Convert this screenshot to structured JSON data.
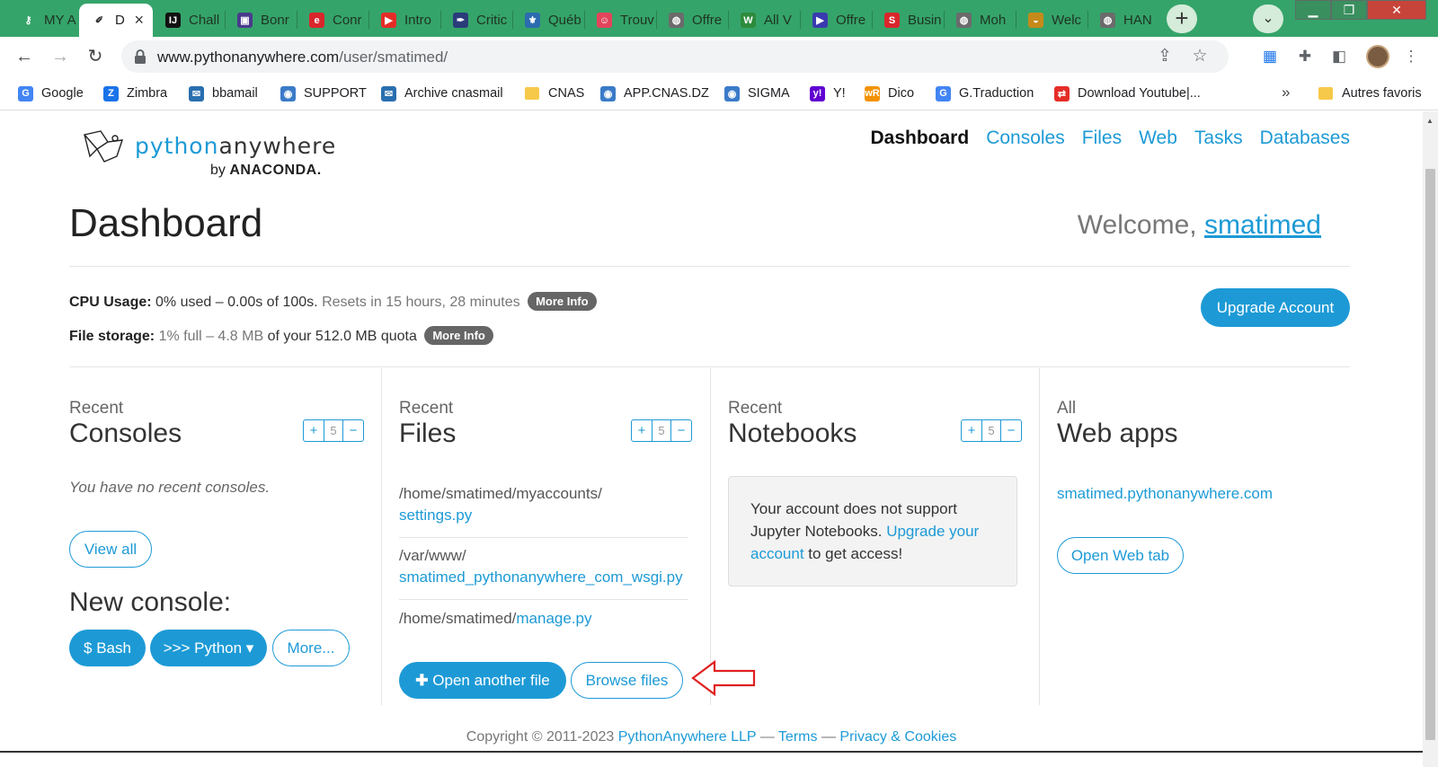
{
  "browser": {
    "tabs": [
      {
        "label": "MY A",
        "icon": "key-icon",
        "color": "#35a46a",
        "glyph": "⚷"
      },
      {
        "label": "D",
        "icon": "pythonanywhere-icon",
        "color": "#ffffff",
        "glyph": "✐",
        "active": true
      },
      {
        "label": "Chall",
        "icon": "jetbrains-icon",
        "color": "#111111",
        "glyph": "IJ"
      },
      {
        "label": "Bonr",
        "icon": "purple-square-icon",
        "color": "#4a3a8c",
        "glyph": "▣"
      },
      {
        "label": "Conr",
        "icon": "e-icon",
        "color": "#d9262c",
        "glyph": "e"
      },
      {
        "label": "Intro",
        "icon": "youtube-icon",
        "color": "#e52d27",
        "glyph": "▶"
      },
      {
        "label": "Critic",
        "icon": "feather-icon",
        "color": "#2a3c7a",
        "glyph": "✒"
      },
      {
        "label": "Québ",
        "icon": "quebec-icon",
        "color": "#2b6cb0",
        "glyph": "⚜"
      },
      {
        "label": "Trouv",
        "icon": "face-icon",
        "color": "#e3445c",
        "glyph": "☺"
      },
      {
        "label": "Offre",
        "icon": "globe-icon",
        "color": "#6b6b6b",
        "glyph": "◍"
      },
      {
        "label": "All V",
        "icon": "w-icon",
        "color": "#2e8b3d",
        "glyph": "W"
      },
      {
        "label": "Offre",
        "icon": "arrow-icon",
        "color": "#3a3ab0",
        "glyph": "▶"
      },
      {
        "label": "Busin",
        "icon": "s-icon",
        "color": "#d9262c",
        "glyph": "S"
      },
      {
        "label": "Moh",
        "icon": "globe-icon",
        "color": "#6b6b6b",
        "glyph": "◍"
      },
      {
        "label": "Welc",
        "icon": "vision-icon",
        "color": "#c68a1a",
        "glyph": "◒"
      },
      {
        "label": "HAN",
        "icon": "globe-icon",
        "color": "#6b6b6b",
        "glyph": "◍"
      }
    ],
    "url_host": "www.pythonanywhere.com",
    "url_path": "/user/smatimed/",
    "bookmarks": [
      {
        "label": "Google",
        "icon": "google-icon",
        "color": "#4285f4",
        "glyph": "G"
      },
      {
        "label": "Zimbra",
        "icon": "zimbra-icon",
        "color": "#1a73e8",
        "glyph": "Z"
      },
      {
        "label": "bbamail",
        "icon": "mail-icon",
        "color": "#2a6fb0",
        "glyph": "✉"
      },
      {
        "label": "SUPPORT",
        "icon": "support-icon",
        "color": "#3a7bc8",
        "glyph": "◉"
      },
      {
        "label": "Archive cnasmail",
        "icon": "mail-icon",
        "color": "#2a6fb0",
        "glyph": "✉"
      },
      {
        "label": "CNAS",
        "icon": "folder-icon",
        "color": "#f6c94a",
        "glyph": ""
      },
      {
        "label": "APP.CNAS.DZ",
        "icon": "cnas-icon",
        "color": "#3a7bc8",
        "glyph": "◉"
      },
      {
        "label": "SIGMA",
        "icon": "cnas-icon",
        "color": "#3a7bc8",
        "glyph": "◉"
      },
      {
        "label": "Y!",
        "icon": "yahoo-icon",
        "color": "#6001d2",
        "glyph": "y!"
      },
      {
        "label": "Dico",
        "icon": "wordreference-icon",
        "color": "#f39200",
        "glyph": "wR"
      },
      {
        "label": "G.Traduction",
        "icon": "translate-icon",
        "color": "#4285f4",
        "glyph": "G"
      },
      {
        "label": "Download Youtube|...",
        "icon": "download-icon",
        "color": "#e52d27",
        "glyph": "⇄"
      }
    ],
    "more_bookmarks": "»",
    "other_bookmarks": "Autres favoris"
  },
  "header": {
    "logo_python": "python",
    "logo_anywhere": "anywhere",
    "logo_by": "by",
    "logo_anaconda": "ANACONDA.",
    "nav": [
      "Dashboard",
      "Consoles",
      "Files",
      "Web",
      "Tasks",
      "Databases"
    ]
  },
  "dashboard": {
    "title": "Dashboard",
    "welcome_prefix": "Welcome,",
    "username": "smatimed",
    "cpu": {
      "label": "CPU Usage:",
      "value": "0% used – 0.00s of 100s.",
      "reset": "Resets in 15 hours, 28 minutes",
      "more": "More Info"
    },
    "storage": {
      "label": "File storage:",
      "pct": "1% full –",
      "used": "4.8 MB",
      "quota": "of your 512.0 MB quota",
      "more": "More Info"
    },
    "upgrade": "Upgrade Account"
  },
  "consoles": {
    "top": "Recent",
    "title": "Consoles",
    "count": "5",
    "empty": "You have no recent consoles.",
    "view_all": "View all",
    "new_title": "New console:",
    "bash": "$ Bash",
    "python": ">>> Python ▾",
    "more": "More..."
  },
  "files": {
    "top": "Recent",
    "title": "Files",
    "count": "5",
    "item1_dir": "/home/smatimed/myaccounts/",
    "item1_file": "settings.py",
    "item2_dir": "/var/www/",
    "item2_file": "smatimed_pythonanywhere_com_wsgi.py",
    "item3_dir": "/home/smatimed/",
    "item3_file": "manage.py",
    "open_another": "Open another file",
    "browse": "Browse files"
  },
  "notebooks": {
    "top": "Recent",
    "title": "Notebooks",
    "count": "5",
    "msg_start": "Your account does not support Jupyter Notebooks.",
    "msg_link": "Upgrade your account",
    "msg_end": "to get access!"
  },
  "webapps": {
    "top": "All",
    "title": "Web apps",
    "app": "smatimed.pythonanywhere.com",
    "open_tab": "Open Web tab"
  },
  "footer": {
    "copyright": "Copyright © 2011-2023",
    "company": "PythonAnywhere LLP",
    "dash1": "—",
    "terms": "Terms",
    "dash2": "—",
    "privacy": "Privacy & Cookies"
  },
  "colors": {
    "accent": "#1d9ad6",
    "tabbar": "#35a46a",
    "annotation": "#e02020"
  }
}
